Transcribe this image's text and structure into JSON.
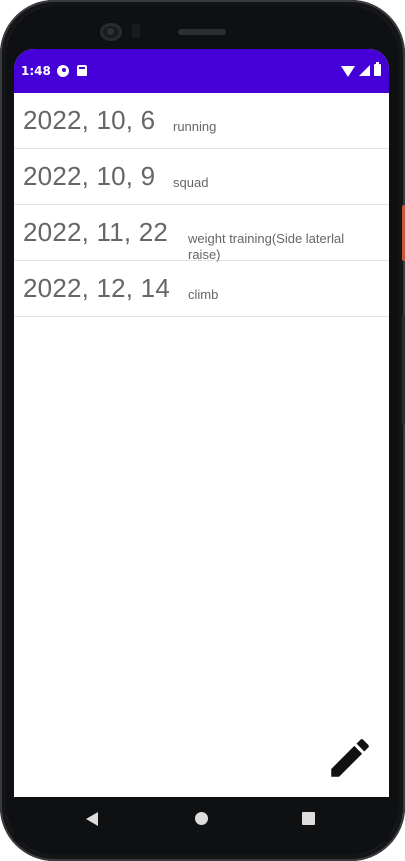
{
  "status_bar": {
    "time": "1:48",
    "icons": [
      "cast-icon",
      "sd-card-icon",
      "wifi-icon",
      "signal-icon",
      "battery-icon"
    ],
    "background": "#4500d8"
  },
  "entries": [
    {
      "date": "2022, 10, 6",
      "activity": "running"
    },
    {
      "date": "2022, 10, 9",
      "activity": "squad"
    },
    {
      "date": "2022, 11, 22",
      "activity": "weight training(Side laterlal raise)"
    },
    {
      "date": "2022, 12, 14",
      "activity": "climb"
    }
  ],
  "fab": {
    "icon": "pencil-icon"
  },
  "nav_bar": {
    "icons": [
      "back-icon",
      "home-icon",
      "recent-apps-icon"
    ]
  },
  "colors": {
    "text": "#666666",
    "divider": "#e2e2e2",
    "accent": "#4500d8"
  }
}
